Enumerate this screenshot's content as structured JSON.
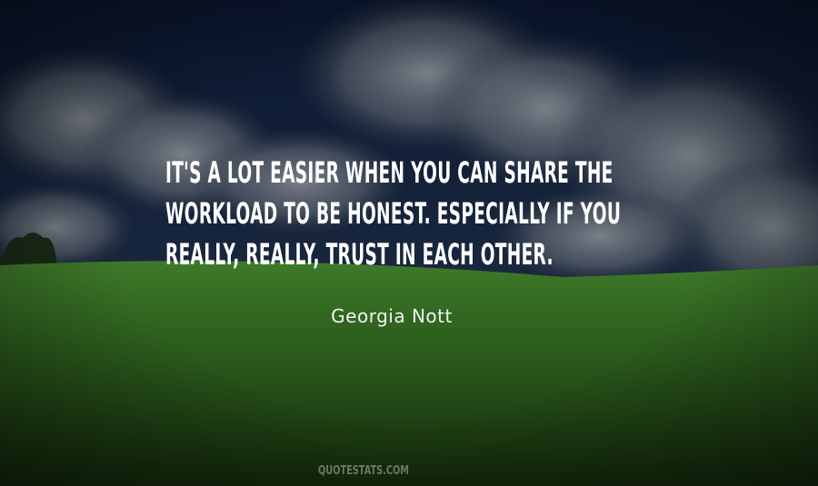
{
  "quote": {
    "lines": [
      "IT'S A LOT EASIER WHEN YOU CAN SHARE THE",
      "WORKLOAD TO BE HONEST. ESPECIALLY IF YOU",
      "REALLY, REALLY, TRUST IN EACH OTHER."
    ]
  },
  "author": "Georgia Nott",
  "watermark": "QUOTESTATS.COM",
  "colors": {
    "sky_top": "#0d1a33",
    "grass": "#2f6b1f",
    "text": "#ffffff"
  }
}
